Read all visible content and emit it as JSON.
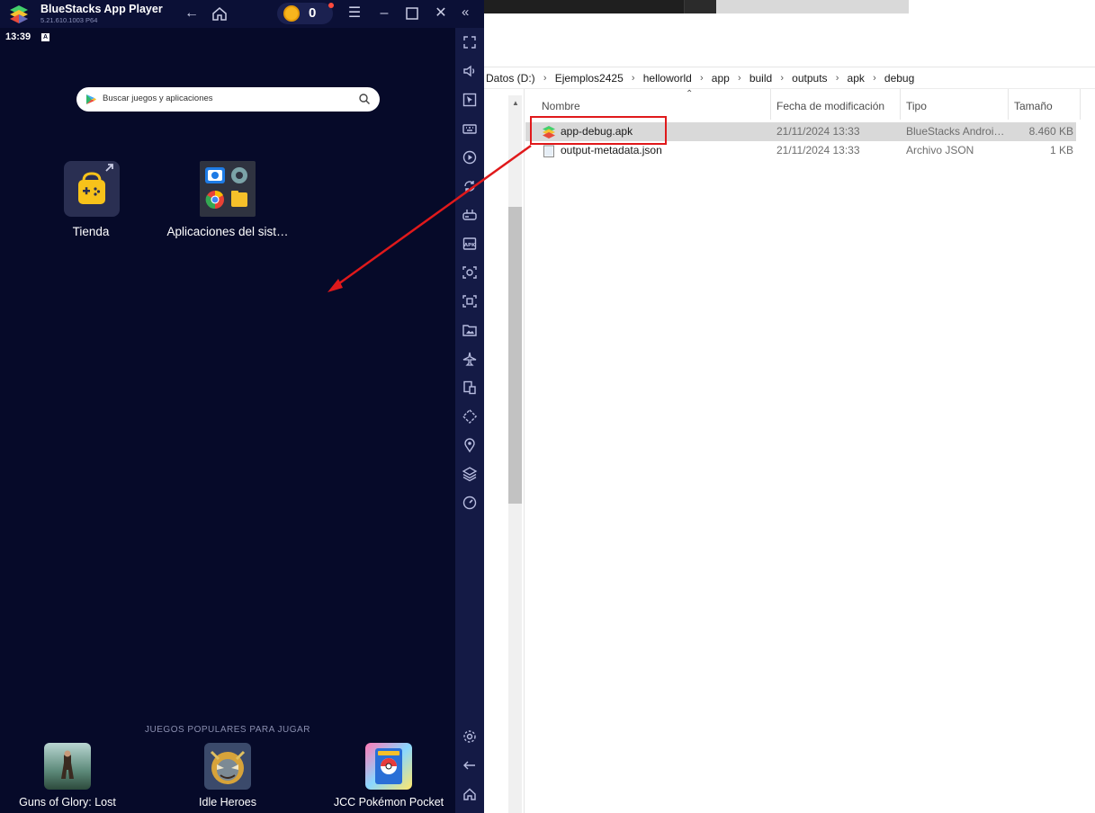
{
  "bluestacks": {
    "app_name": "BlueStacks App Player",
    "version": "5.21.610.1003 P64",
    "coins": "0",
    "clock": "13:39",
    "status_indicator": "A",
    "search_placeholder": "Buscar juegos y aplicaciones",
    "apps": [
      {
        "label": "Tienda",
        "icon": "store-bag-icon"
      },
      {
        "label": "Aplicaciones del sist…",
        "icon": "system-apps-folder-icon"
      }
    ],
    "popular_title": "JUEGOS POPULARES PARA JUGAR",
    "games": [
      {
        "label": "Guns of Glory: Lost"
      },
      {
        "label": "Idle Heroes"
      },
      {
        "label": "JCC Pokémon Pocket"
      }
    ],
    "sidebar_icons": [
      "fullscreen-icon",
      "volume-icon",
      "pointer-icon",
      "keyboard-icon",
      "macro-icon",
      "sync-icon",
      "gamepad-icon",
      "apk-install-icon",
      "screenshot-icon",
      "screen-record-icon",
      "media-folder-icon",
      "airplane-mode-icon",
      "multi-instance-icon",
      "rotate-icon",
      "location-icon",
      "layers-icon",
      "performance-icon",
      "settings-icon",
      "back-icon",
      "home-icon"
    ]
  },
  "explorer": {
    "breadcrumb": [
      "Datos (D:)",
      "Ejemplos2425",
      "helloworld",
      "app",
      "build",
      "outputs",
      "apk",
      "debug"
    ],
    "columns": {
      "name": "Nombre",
      "date": "Fecha de modificación",
      "type": "Tipo",
      "size": "Tamaño"
    },
    "files": [
      {
        "name": "app-debug.apk",
        "date": "21/11/2024 13:33",
        "type": "BlueStacks Androi…",
        "size": "8.460 KB",
        "selected": true,
        "icon": "bluestacks-apk-icon"
      },
      {
        "name": "output-metadata.json",
        "date": "21/11/2024 13:33",
        "type": "Archivo JSON",
        "size": "1 KB",
        "selected": false,
        "icon": "json-file-icon"
      }
    ]
  },
  "colors": {
    "annotation_red": "#e0191b",
    "bs_background": "#060a29",
    "bs_sidebar": "#141a45"
  }
}
